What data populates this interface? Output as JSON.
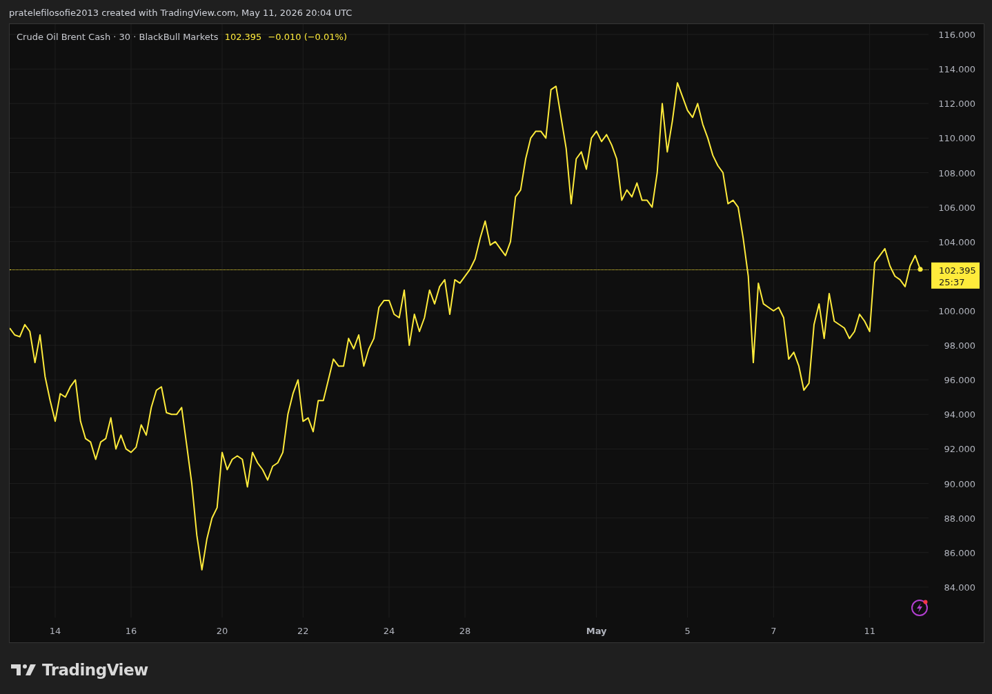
{
  "header": {
    "text": "pratelefilosofie2013 created with TradingView.com, May 11, 2026 20:04 UTC"
  },
  "chart": {
    "legend": {
      "symbol": "Crude Oil Brent Cash · 30 · BlackBull Markets",
      "price": "102.395",
      "change": "−0.010 (−0.01%)"
    },
    "price_tag": {
      "price": "102.395",
      "countdown": "25:37"
    },
    "chart_data": {
      "type": "line",
      "grid": true,
      "ylim": [
        82.24,
        116.6
      ],
      "categories": [
        null,
        null,
        null,
        null,
        null,
        null,
        null,
        null,
        null,
        "14",
        null,
        null,
        null,
        null,
        null,
        null,
        null,
        null,
        null,
        null,
        null,
        null,
        null,
        null,
        "16",
        null,
        null,
        null,
        null,
        null,
        null,
        null,
        null,
        null,
        null,
        null,
        null,
        null,
        null,
        null,
        null,
        null,
        "20",
        null,
        null,
        null,
        null,
        null,
        null,
        null,
        null,
        null,
        null,
        null,
        null,
        null,
        null,
        null,
        "22",
        null,
        null,
        null,
        null,
        null,
        null,
        null,
        null,
        null,
        null,
        null,
        null,
        null,
        null,
        null,
        null,
        "24",
        null,
        null,
        null,
        null,
        null,
        null,
        null,
        null,
        null,
        null,
        null,
        null,
        null,
        null,
        "28",
        null,
        null,
        null,
        null,
        null,
        null,
        null,
        null,
        null,
        null,
        null,
        null,
        null,
        null,
        null,
        null,
        null,
        null,
        null,
        null,
        null,
        null,
        null,
        null,
        null,
        "May",
        null,
        null,
        null,
        null,
        null,
        null,
        null,
        null,
        null,
        null,
        null,
        null,
        null,
        null,
        null,
        null,
        null,
        "5",
        null,
        null,
        null,
        null,
        null,
        null,
        null,
        null,
        null,
        null,
        null,
        null,
        null,
        null,
        null,
        null,
        "7",
        null,
        null,
        null,
        null,
        null,
        null,
        null,
        null,
        null,
        null,
        null,
        null,
        null,
        null,
        null,
        null,
        null,
        null,
        "11",
        null,
        null,
        null,
        null,
        null,
        null,
        null,
        null,
        null,
        null
      ],
      "series": [
        {
          "color": "#ffeb3b",
          "values": [
            99.0,
            98.6,
            98.5,
            99.2,
            98.8,
            97.0,
            98.6,
            96.2,
            94.8,
            93.6,
            95.2,
            95.0,
            95.6,
            96.0,
            93.6,
            92.6,
            92.4,
            91.4,
            92.4,
            92.6,
            93.8,
            92.0,
            92.8,
            92.0,
            91.8,
            92.1,
            93.4,
            92.8,
            94.4,
            95.4,
            95.6,
            94.1,
            94.0,
            94.0,
            94.4,
            92.2,
            90.0,
            87.0,
            85.0,
            86.8,
            88.0,
            88.6,
            91.8,
            90.8,
            91.4,
            91.6,
            91.4,
            89.8,
            91.8,
            91.2,
            90.8,
            90.2,
            91.0,
            91.2,
            91.8,
            94.0,
            95.2,
            96.0,
            93.6,
            93.8,
            93.0,
            94.8,
            94.8,
            96.0,
            97.2,
            96.8,
            96.8,
            98.4,
            97.8,
            98.6,
            96.8,
            97.8,
            98.4,
            100.2,
            100.6,
            100.6,
            99.8,
            99.6,
            101.2,
            98.0,
            99.8,
            98.8,
            99.6,
            101.2,
            100.4,
            101.4,
            101.8,
            99.8,
            101.8,
            101.6,
            102.0,
            102.4,
            103.0,
            104.2,
            105.2,
            103.8,
            104.0,
            103.6,
            103.2,
            104.0,
            106.6,
            107.0,
            108.8,
            110.0,
            110.4,
            110.4,
            110.0,
            112.8,
            113.0,
            111.2,
            109.4,
            106.2,
            108.8,
            109.2,
            108.2,
            110.0,
            110.4,
            109.8,
            110.2,
            109.6,
            108.8,
            106.4,
            107.0,
            106.6,
            107.4,
            106.4,
            106.4,
            106.0,
            108.0,
            112.0,
            109.2,
            111.0,
            113.2,
            112.4,
            111.6,
            111.2,
            112.0,
            110.8,
            110.0,
            109.0,
            108.4,
            108.0,
            106.2,
            106.4,
            106.0,
            104.2,
            102.0,
            97.0,
            101.6,
            100.4,
            100.2,
            100.0,
            100.2,
            99.6,
            97.2,
            97.6,
            96.8,
            95.4,
            95.8,
            99.2,
            100.4,
            98.4,
            101.0,
            99.4,
            99.2,
            99.0,
            98.4,
            98.8,
            99.8,
            99.4,
            98.8,
            102.8,
            103.2,
            103.6,
            102.6,
            102.0,
            101.8,
            101.4,
            102.6,
            103.2,
            102.4
          ]
        }
      ],
      "yticks": [
        {
          "value": 84,
          "label": "84.000"
        },
        {
          "value": 86,
          "label": "86.000"
        },
        {
          "value": 88,
          "label": "88.000"
        },
        {
          "value": 90,
          "label": "90.000"
        },
        {
          "value": 92,
          "label": "92.000"
        },
        {
          "value": 94,
          "label": "94.000"
        },
        {
          "value": 96,
          "label": "96.000"
        },
        {
          "value": 98,
          "label": "98.000"
        },
        {
          "value": 100,
          "label": "100.000"
        },
        {
          "value": 104,
          "label": "104.000"
        },
        {
          "value": 106,
          "label": "106.000"
        },
        {
          "value": 108,
          "label": "108.000"
        },
        {
          "value": 110,
          "label": "110.000"
        },
        {
          "value": 112,
          "label": "112.000"
        },
        {
          "value": 114,
          "label": "114.000"
        },
        {
          "value": 116,
          "label": "116.000"
        }
      ]
    }
  },
  "logo": {
    "text": "TradingView"
  }
}
